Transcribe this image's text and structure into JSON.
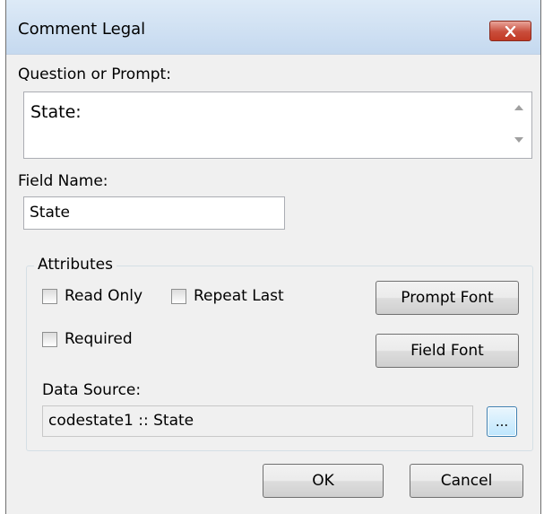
{
  "window": {
    "title": "Comment Legal"
  },
  "prompt": {
    "label": "Question or Prompt:",
    "value": "State:"
  },
  "field": {
    "label": "Field Name:",
    "value": "State"
  },
  "attributes": {
    "label": "Attributes",
    "read_only": {
      "label": "Read Only",
      "checked": false
    },
    "repeat_last": {
      "label": "Repeat Last",
      "checked": false
    },
    "required": {
      "label": "Required",
      "checked": false
    },
    "prompt_font_label": "Prompt Font",
    "field_font_label": "Field Font"
  },
  "data_source": {
    "label": "Data Source:",
    "value": "codestate1 :: State",
    "browse_label": "..."
  },
  "buttons": {
    "ok": "OK",
    "cancel": "Cancel"
  },
  "icons": {
    "close": "close-icon",
    "scroll_up": "scroll-up-arrow-icon",
    "scroll_down": "scroll-down-arrow-icon"
  },
  "colors": {
    "close_button": "#c94d3b",
    "titlebar": "#c5d9ef",
    "focus_border": "#3c7fb1"
  }
}
